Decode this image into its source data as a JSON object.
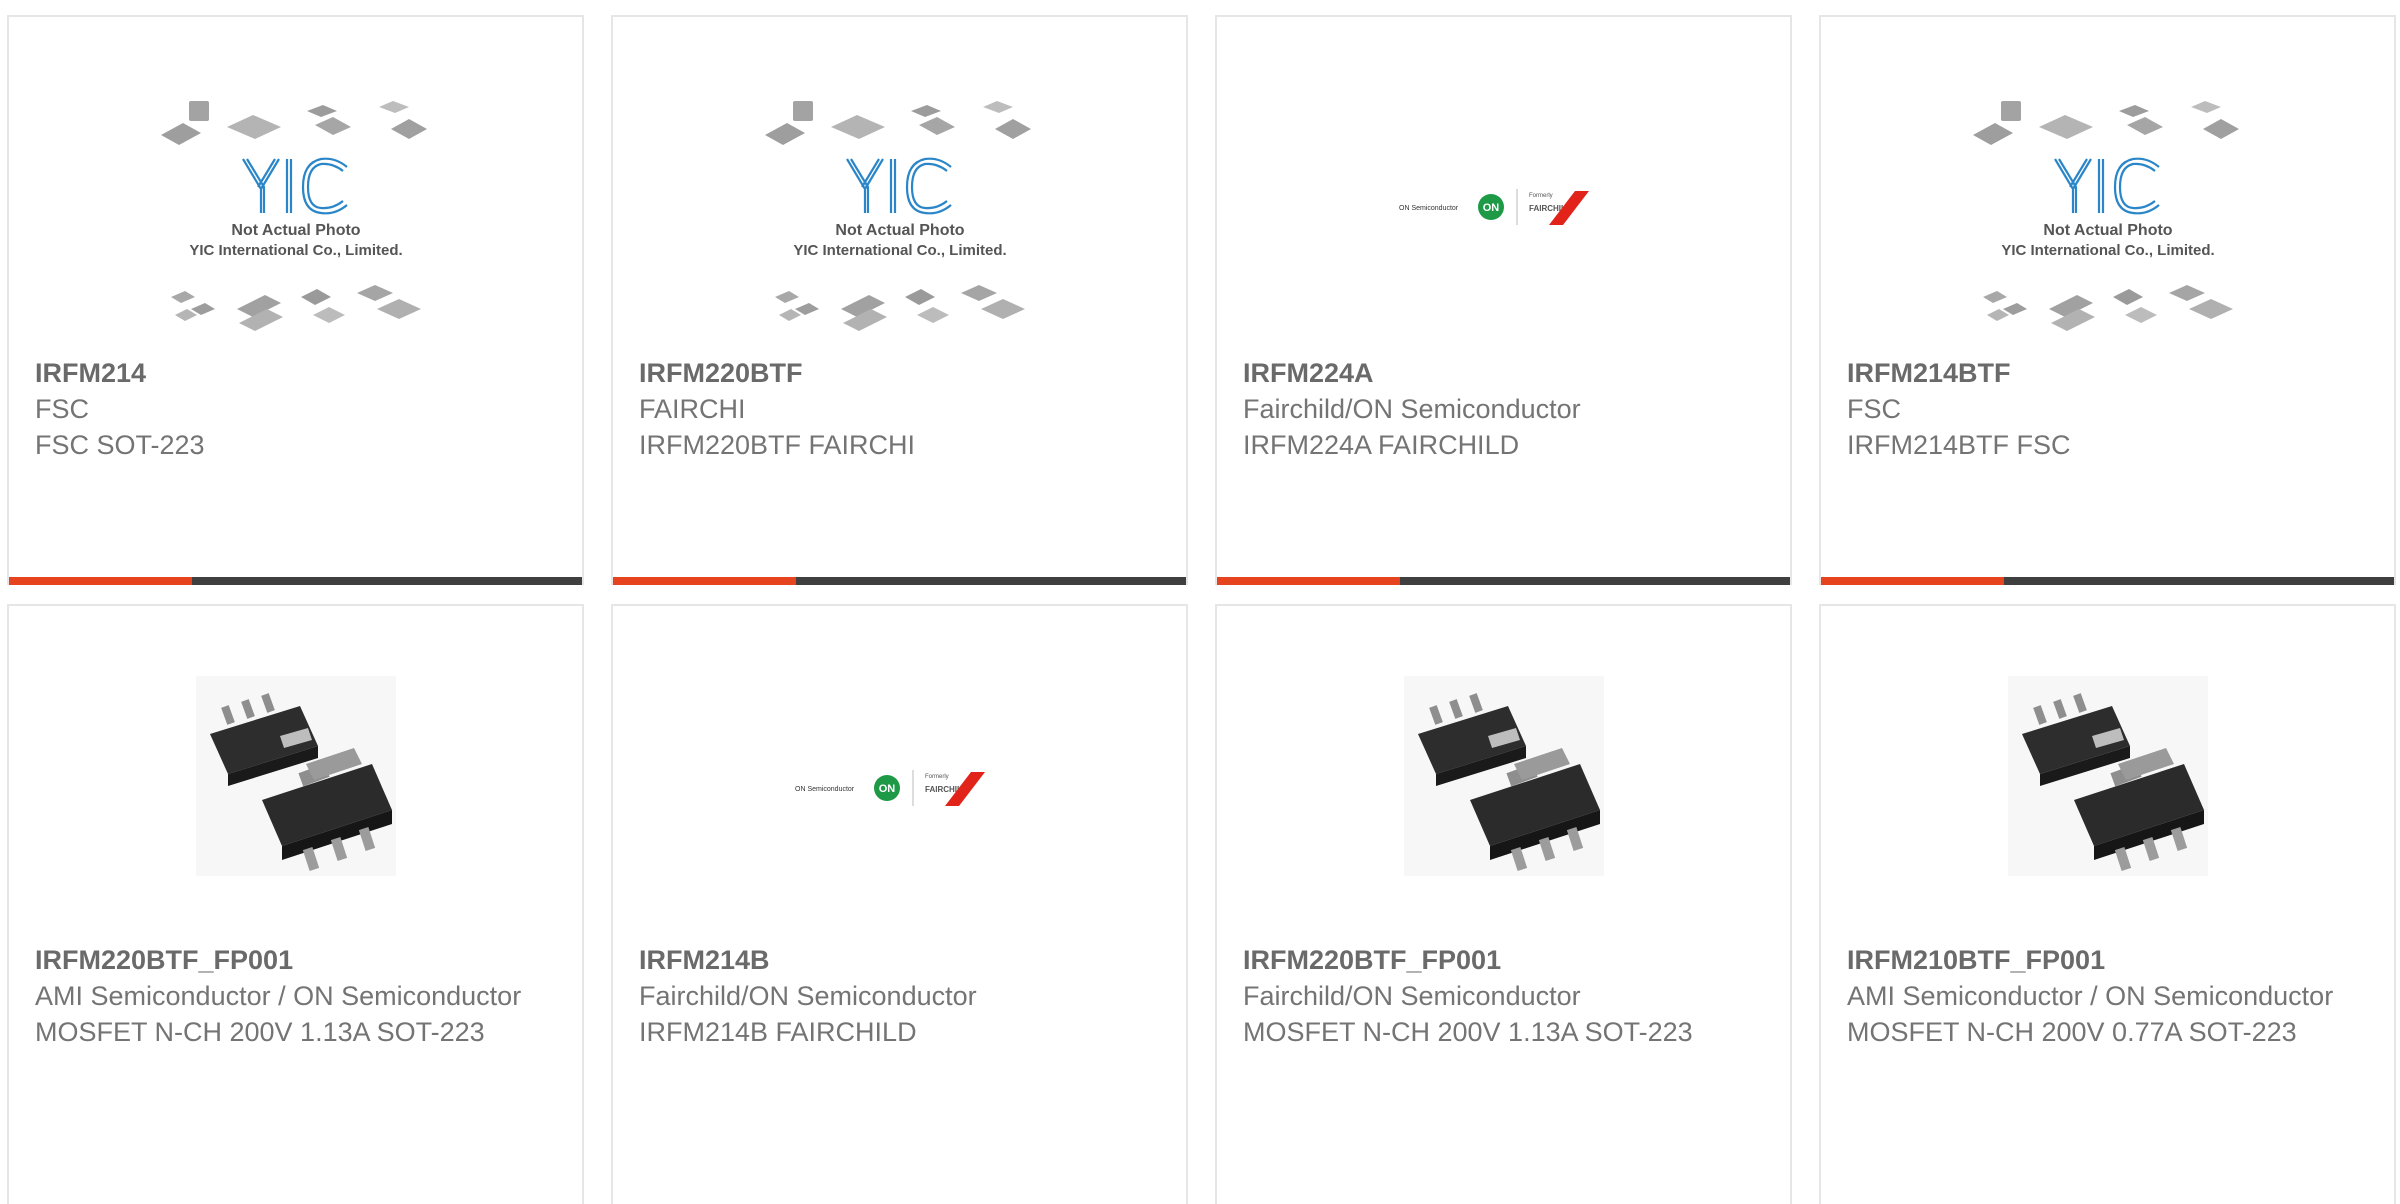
{
  "theme": {
    "accent": "#e6431f",
    "bar": "#3f3f3f",
    "border": "#e6e6e6",
    "text": "#747474",
    "yic_blue": "#2a86c8"
  },
  "placeholder_image": {
    "brand": "YIC",
    "line1": "Not Actual Photo",
    "line2": "YIC International Co., Limited."
  },
  "logo_image": {
    "left_text": "ON Semiconductor",
    "badge": "ON",
    "formerly": "Formerly",
    "right_text": "FAIRCHILD."
  },
  "products": [
    {
      "image": "yic-placeholder",
      "part": "IRFM214",
      "manufacturer": "FSC",
      "description": "FSC SOT-223"
    },
    {
      "image": "yic-placeholder",
      "part": "IRFM220BTF",
      "manufacturer": "FAIRCHI",
      "description": "IRFM220BTF FAIRCHI"
    },
    {
      "image": "on-fairchild-logo",
      "part": "IRFM224A",
      "manufacturer": "Fairchild/ON Semiconductor",
      "description": "IRFM224A FAIRCHILD"
    },
    {
      "image": "yic-placeholder",
      "part": "IRFM214BTF",
      "manufacturer": "FSC",
      "description": "IRFM214BTF FSC"
    },
    {
      "image": "sot223-photo",
      "part": "IRFM220BTF_FP001",
      "manufacturer": "AMI Semiconductor / ON Semiconductor",
      "description": "MOSFET N-CH 200V 1.13A SOT-223"
    },
    {
      "image": "on-fairchild-logo",
      "part": "IRFM214B",
      "manufacturer": "Fairchild/ON Semiconductor",
      "description": "IRFM214B FAIRCHILD"
    },
    {
      "image": "sot223-photo",
      "part": "IRFM220BTF_FP001",
      "manufacturer": "Fairchild/ON Semiconductor",
      "description": "MOSFET N-CH 200V 1.13A SOT-223"
    },
    {
      "image": "sot223-photo",
      "part": "IRFM210BTF_FP001",
      "manufacturer": "AMI Semiconductor / ON Semiconductor",
      "description": "MOSFET N-CH 200V 0.77A SOT-223"
    }
  ]
}
